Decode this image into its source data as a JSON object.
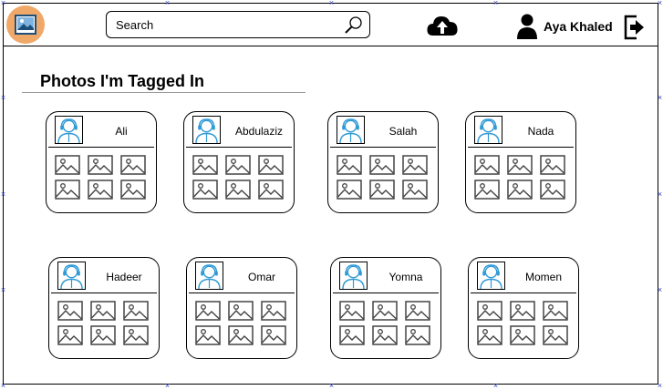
{
  "header": {
    "logo_icon": "image-icon",
    "search": {
      "placeholder": "Search",
      "icon": "search-icon"
    },
    "upload_icon": "cloud-upload-icon",
    "user": {
      "icon": "user-icon",
      "name": "Aya Khaled"
    },
    "logout_icon": "logout-icon"
  },
  "page": {
    "title": "Photos I'm Tagged In"
  },
  "cards": [
    {
      "name": "Ali"
    },
    {
      "name": "Abdulaziz"
    },
    {
      "name": "Salah"
    },
    {
      "name": "Nada"
    },
    {
      "name": "Hadeer"
    },
    {
      "name": "Omar"
    },
    {
      "name": "Yomna"
    },
    {
      "name": "Momen"
    }
  ],
  "colors": {
    "logo_bg": "#f0a868",
    "avatar_blue": "#2f9ad6",
    "handle_blue": "#3b4bbd"
  }
}
